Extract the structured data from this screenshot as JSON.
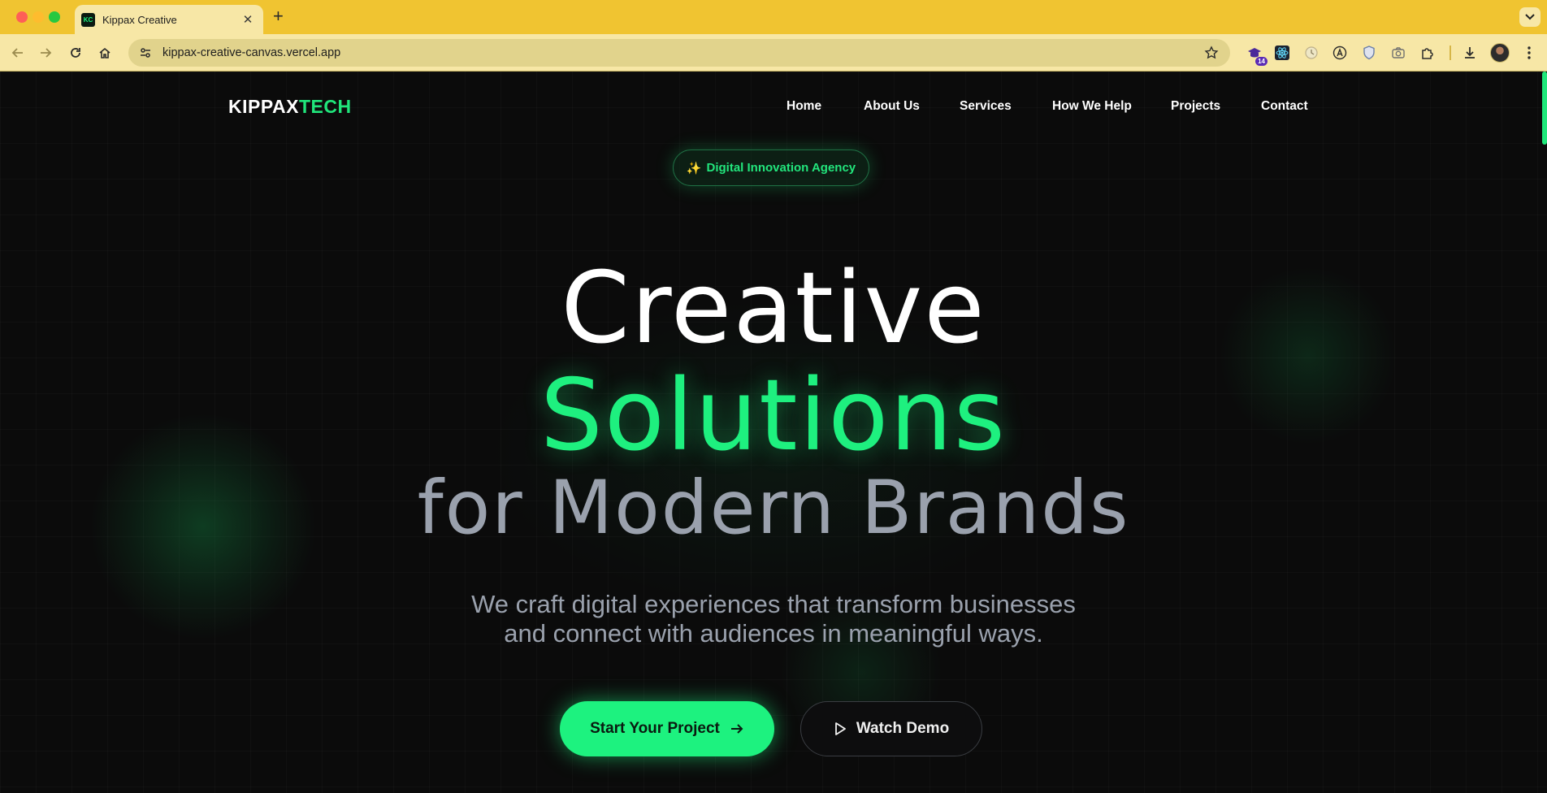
{
  "browser": {
    "tab_title": "Kippax Creative",
    "tab_favicon_text": "KC",
    "url": "kippax-creative-canvas.vercel.app",
    "extension_badge_count": "14"
  },
  "site": {
    "logo_primary": "KIPPAX",
    "logo_accent": "TECH",
    "accent_color": "#1ef07f",
    "nav": [
      {
        "label": "Home"
      },
      {
        "label": "About Us"
      },
      {
        "label": "Services"
      },
      {
        "label": "How We Help"
      },
      {
        "label": "Projects"
      },
      {
        "label": "Contact"
      }
    ]
  },
  "hero": {
    "badge_icon": "✨",
    "badge_text": "Digital Innovation Agency",
    "line1": "Creative",
    "line2": "Solutions",
    "line3": "for Modern Brands",
    "subtitle_line1": "We craft digital experiences that transform businesses",
    "subtitle_line2": "and connect with audiences in meaningful ways.",
    "primary_cta": "Start Your Project",
    "secondary_cta": "Watch Demo"
  },
  "icons": {
    "back": "arrow-left-icon",
    "forward": "arrow-right-icon",
    "reload": "reload-icon",
    "home": "home-icon",
    "site_info": "tune-icon",
    "bookmark": "star-icon",
    "extensions": "puzzle-icon",
    "downloads": "download-icon",
    "menu": "kebab-menu-icon"
  }
}
